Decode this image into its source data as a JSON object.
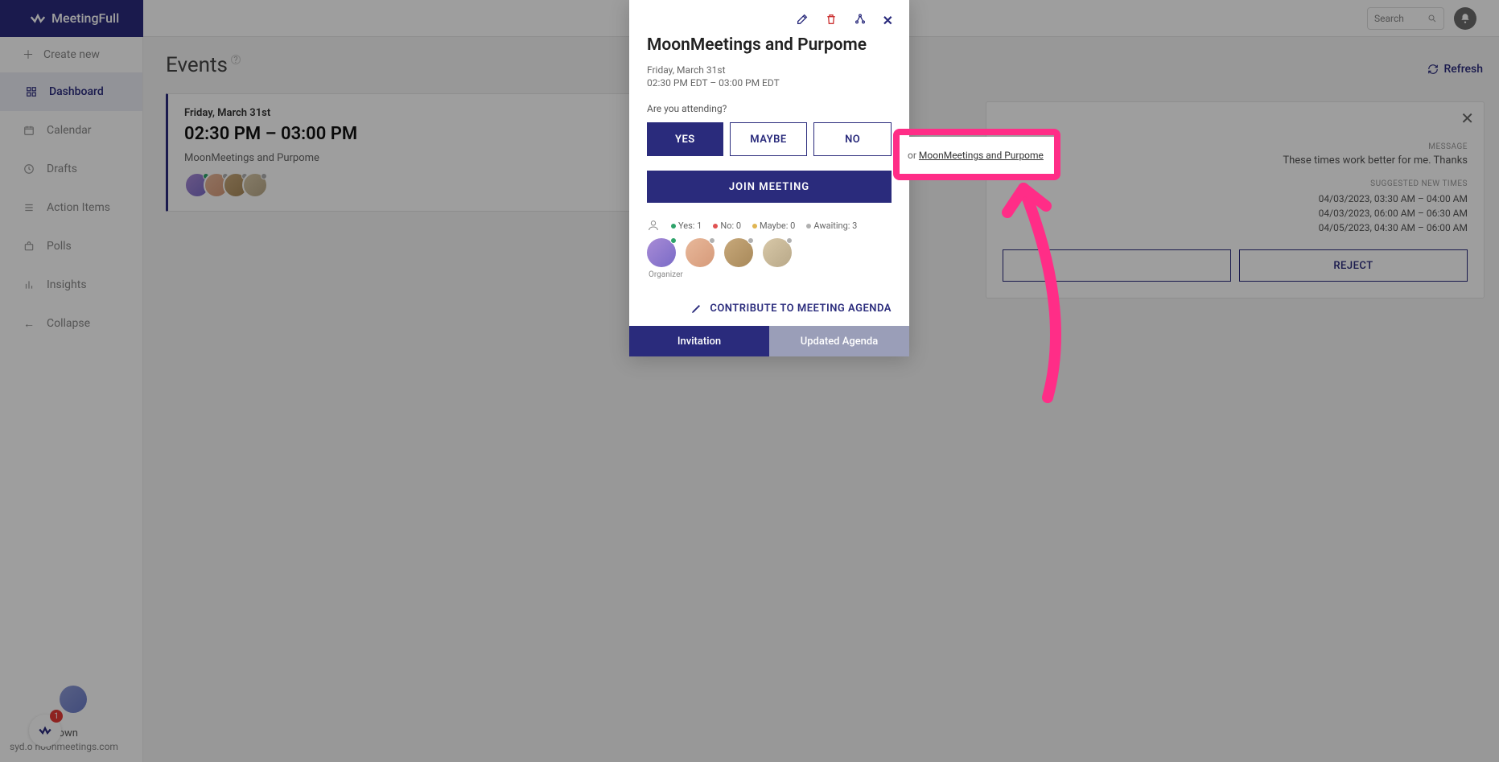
{
  "brand": "MeetingFull",
  "topbar": {
    "search_placeholder": "Search"
  },
  "sidebar": {
    "create_label": "Create new",
    "items": [
      {
        "label": "Dashboard"
      },
      {
        "label": "Calendar"
      },
      {
        "label": "Drafts"
      },
      {
        "label": "Action Items"
      },
      {
        "label": "Polls"
      },
      {
        "label": "Insights"
      },
      {
        "label": "Collapse"
      }
    ],
    "profile": {
      "name_fragment": "Down",
      "email_fragment": "syd.o          noonmeetings.com",
      "badge": "1"
    }
  },
  "main": {
    "title": "Events",
    "refresh_label": "Refresh",
    "event": {
      "date": "Friday, March 31st",
      "time": "02:30 PM – 03:00 PM",
      "name": "MoonMeetings and Purpome"
    }
  },
  "suggest": {
    "link_prefix": "or ",
    "link_text": "MoonMeetings and Purpome",
    "message_label": "MESSAGE",
    "message": "These times work better for me. Thanks",
    "times_label": "SUGGESTED NEW TIMES",
    "times": [
      "04/03/2023, 03:30 AM – 04:00 AM",
      "04/03/2023, 06:00 AM – 06:30 AM",
      "04/05/2023, 04:30 AM – 06:00 AM"
    ],
    "accept_label": "",
    "reject_label": "REJECT"
  },
  "modal": {
    "title": "MoonMeetings and Purpome",
    "date": "Friday, March 31st",
    "time": "02:30 PM EDT – 03:00 PM EDT",
    "attending_q": "Are you attending?",
    "yes": "YES",
    "maybe": "MAYBE",
    "no": "NO",
    "join": "JOIN MEETING",
    "stats": {
      "yes": "Yes: 1",
      "no": "No: 0",
      "maybe": "Maybe: 0",
      "awaiting": "Awaiting: 3"
    },
    "organizer": "Organizer",
    "contribute": "CONTRIBUTE TO MEETING AGENDA",
    "tab_invitation": "Invitation",
    "tab_agenda": "Updated Agenda"
  },
  "colors": {
    "dot_yes": "#2ea36a",
    "dot_no": "#e05252",
    "dot_maybe": "#e0b552",
    "dot_await": "#b0b0b0"
  }
}
